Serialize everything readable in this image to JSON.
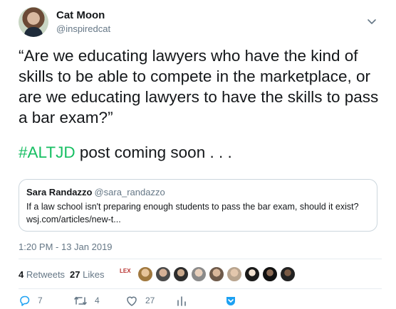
{
  "tweet": {
    "author": {
      "display_name": "Cat Moon",
      "handle": "@inspiredcat"
    },
    "text_main": "“Are we educating lawyers who have the kind of skills to be able to compete in the marketplace, or are we educating lawyers to have the skills to pass a bar exam?”",
    "hashtag": "#ALTJD",
    "text_after_hashtag": " post coming soon . . .",
    "quote": {
      "display_name": "Sara Randazzo",
      "handle": "@sara_randazzo",
      "line1": "If a law school isn't preparing enough students to pass the bar exam, should it exist?",
      "line2": "wsj.com/articles/new-t..."
    },
    "timestamp": "1:20 PM - 13 Jan 2019",
    "stats": {
      "retweets_count": "4",
      "retweets_label": "Retweets",
      "likes_count": "27",
      "likes_label": "Likes",
      "liker_logo_text": "LEX"
    },
    "actions": {
      "reply_count": "7",
      "retweet_count": "4",
      "like_count": "27"
    }
  },
  "colors": {
    "hashtag": "#17bf63",
    "secondary_text": "#657786",
    "primary_text": "#14171a",
    "border": "#ccd6dd"
  },
  "icons": [
    "chevron-down-icon",
    "reply-icon",
    "retweet-icon",
    "heart-icon",
    "analytics-icon",
    "direct-message-icon"
  ]
}
